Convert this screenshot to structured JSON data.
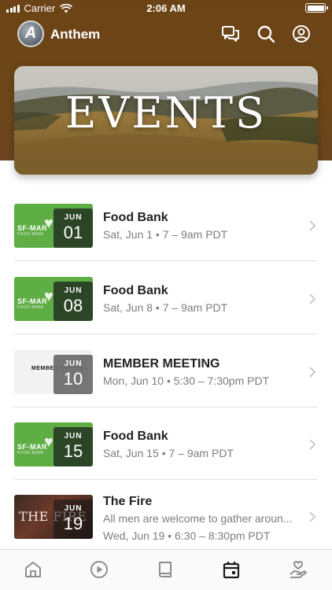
{
  "status_bar": {
    "carrier": "Carrier",
    "time": "2:06 AM"
  },
  "header": {
    "app_name": "Anthem",
    "logo_letter": "A",
    "icons": [
      "chat-icon",
      "search-icon",
      "profile-icon"
    ]
  },
  "banner": {
    "title": "EVENTS"
  },
  "events": [
    {
      "title": "Food Bank",
      "month": "JUN",
      "day": "01",
      "time": "Sat, Jun 1 • 7 – 9am PDT",
      "thumb_caption": "SF-MAR",
      "thumb_sub": "FOOD BANK"
    },
    {
      "title": "Food Bank",
      "month": "JUN",
      "day": "08",
      "time": "Sat, Jun 8 • 7 – 9am PDT",
      "thumb_caption": "SF-MAR",
      "thumb_sub": "FOOD BANK"
    },
    {
      "title": "MEMBER MEETING",
      "month": "JUN",
      "day": "10",
      "time": "Mon, Jun 10 • 5:30 – 7:30pm PDT",
      "thumb_caption": "MEMBER MEETING",
      "thumb_sub": ""
    },
    {
      "title": "Food Bank",
      "month": "JUN",
      "day": "15",
      "time": "Sat, Jun 15 • 7 – 9am PDT",
      "thumb_caption": "SF-MAR",
      "thumb_sub": "FOOD BANK"
    },
    {
      "title": "The Fire",
      "month": "JUN",
      "day": "19",
      "description": "All men are welcome to gather aroun...",
      "time": "Wed, Jun 19 • 6:30 – 8:30pm PDT",
      "thumb_caption": "THE FIRE",
      "thumb_sub": ""
    }
  ],
  "tabs": [
    "home-icon",
    "play-icon",
    "book-icon",
    "calendar-icon",
    "giving-icon"
  ],
  "colors": {
    "header_brown": "#6b4316",
    "food_bank_green": "#5fae45",
    "active_tab": "#1a1a1a",
    "inactive_tab": "#8e8e93"
  }
}
